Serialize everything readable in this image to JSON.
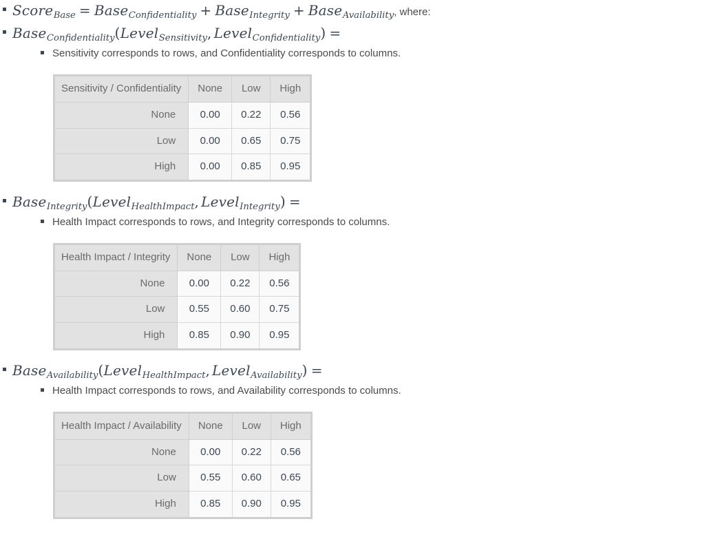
{
  "formulas": {
    "score_base": {
      "lhs_base": "Score",
      "lhs_sub": "Base",
      "eq": "=",
      "t1": "Base",
      "t1_sub": "Confidentiality",
      "plus1": "+",
      "t2": "Base",
      "t2_sub": "Integrity",
      "plus2": "+",
      "t3": "Base",
      "t3_sub": "Availability",
      "tail": ", where:"
    },
    "base_confidentiality": {
      "fn": "Base",
      "fn_sub": "Confidentiality",
      "open": "(",
      "a1": "Level",
      "a1_sub": "Sensitivity",
      "comma": ",",
      "a2": "Level",
      "a2_sub": "Confidentiality",
      "close": ")",
      "eq": "="
    },
    "base_integrity": {
      "fn": "Base",
      "fn_sub": "Integrity",
      "open": "(",
      "a1": "Level",
      "a1_sub": "HealthImpact",
      "comma": ",",
      "a2": "Level",
      "a2_sub": "Integrity",
      "close": ")",
      "eq": "="
    },
    "base_availability": {
      "fn": "Base",
      "fn_sub": "Availability",
      "open": "(",
      "a1": "Level",
      "a1_sub": "HealthImpact",
      "comma": ",",
      "a2": "Level",
      "a2_sub": "Availability",
      "close": ")",
      "eq": "="
    }
  },
  "notes": {
    "confidentiality": "Sensitivity corresponds to rows, and Confidentiality corresponds to columns.",
    "integrity": "Health Impact corresponds to rows, and Integrity corresponds to columns.",
    "availability": "Health Impact corresponds to rows, and Availability corresponds to columns."
  },
  "tables": {
    "confidentiality": {
      "corner": "Sensitivity / Confidentiality",
      "columns": [
        "None",
        "Low",
        "High"
      ],
      "rows": [
        {
          "label": "None",
          "values": [
            "0.00",
            "0.22",
            "0.56"
          ]
        },
        {
          "label": "Low",
          "values": [
            "0.00",
            "0.65",
            "0.75"
          ]
        },
        {
          "label": "High",
          "values": [
            "0.00",
            "0.85",
            "0.95"
          ]
        }
      ]
    },
    "integrity": {
      "corner": "Health Impact / Integrity",
      "columns": [
        "None",
        "Low",
        "High"
      ],
      "rows": [
        {
          "label": "None",
          "values": [
            "0.00",
            "0.22",
            "0.56"
          ]
        },
        {
          "label": "Low",
          "values": [
            "0.55",
            "0.60",
            "0.75"
          ]
        },
        {
          "label": "High",
          "values": [
            "0.85",
            "0.90",
            "0.95"
          ]
        }
      ]
    },
    "availability": {
      "corner": "Health Impact / Availability",
      "columns": [
        "None",
        "Low",
        "High"
      ],
      "rows": [
        {
          "label": "None",
          "values": [
            "0.00",
            "0.22",
            "0.56"
          ]
        },
        {
          "label": "Low",
          "values": [
            "0.55",
            "0.60",
            "0.65"
          ]
        },
        {
          "label": "High",
          "values": [
            "0.85",
            "0.90",
            "0.95"
          ]
        }
      ]
    }
  },
  "colors": {
    "text": "#4a4a4a",
    "math": "#3d4753",
    "table_border": "#cfcfcf",
    "header_bg": "#e2e2e2",
    "cell_bg": "#fafafa"
  }
}
